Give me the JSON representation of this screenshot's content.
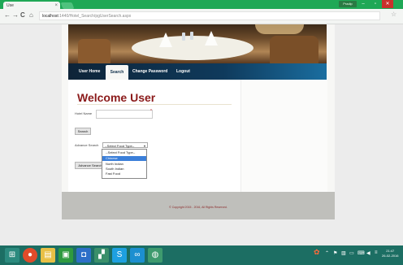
{
  "browser": {
    "tab_title": "Use",
    "tab_close": "×",
    "profile_label": "Pradip",
    "window_controls": [
      "–",
      "▫",
      "✕"
    ],
    "nav": {
      "back": "←",
      "forward": "→",
      "reload": "C",
      "home": "⌂"
    },
    "url": {
      "host": "localhost",
      "path": ":1440/Hotel_Search/pgUserSearch.aspx"
    },
    "star": "☆"
  },
  "nav": {
    "items": [
      {
        "label": "User Home"
      },
      {
        "label": "Search"
      },
      {
        "label": "Change Password"
      },
      {
        "label": "Logout"
      }
    ],
    "active": "Search"
  },
  "main": {
    "heading": "Welcome User",
    "hotel_name_label": "Hotel Name",
    "hotel_name_value": "",
    "required_marker": "*",
    "search_button": "Search",
    "advance_search_label": "Advance Search",
    "food_select_value": "--Select Food Type--",
    "food_select_arrow": "▾",
    "food_options": [
      "--Select Food Type--",
      "Chinese",
      "North Indian",
      "South Indian",
      "Fast Food"
    ],
    "highlighted_option": "Chinese",
    "advance_search_button": "Advance Search"
  },
  "footer": {
    "copyright": "© Copyright 2015 - 2016, All Rights Reserved."
  },
  "taskbar": {
    "icons": [
      "windows-start-icon",
      "chrome-icon",
      "file-explorer-icon",
      "office-icon",
      "outlook-icon",
      "visual-studio-icon",
      "skype-icon",
      "photos-icon",
      "drawing-icon"
    ],
    "clock_time": "21:47",
    "clock_date": "26-02-2016"
  },
  "colors": {
    "chrome_green": "#1fa856",
    "heading": "#8b1a1a",
    "nav_bar": "#0f3a5c",
    "highlight": "#3b7fd9",
    "taskbar": "#1c6e63"
  }
}
